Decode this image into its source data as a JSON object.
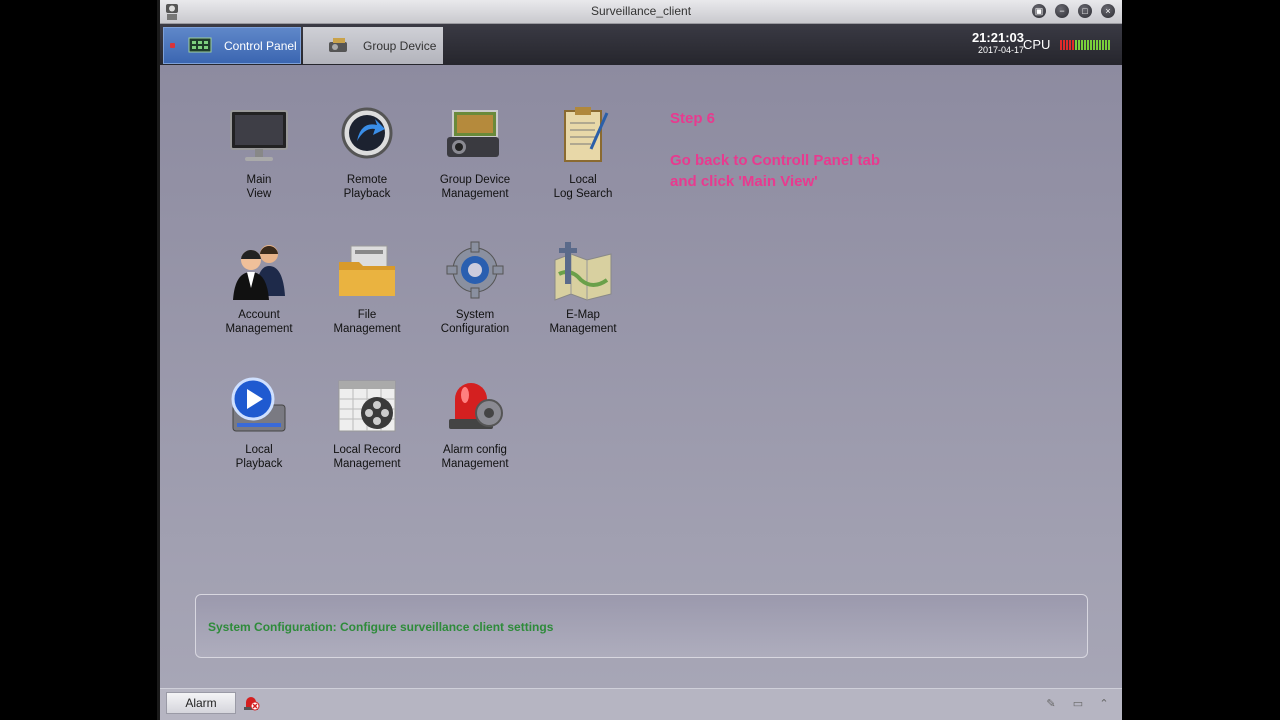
{
  "window": {
    "title": "Surveillance_client"
  },
  "tabs": [
    {
      "label": "Control Panel",
      "icon": "control-panel-icon"
    },
    {
      "label": "Group Device",
      "icon": "group-device-icon"
    }
  ],
  "clock": {
    "time": "21:21:03",
    "date": "2017-04-17"
  },
  "cpu": {
    "label": "CPU",
    "load_fraction": 0.3
  },
  "modules": [
    {
      "label": "Main\nView",
      "icon": "monitor-icon"
    },
    {
      "label": "Remote\nPlayback",
      "icon": "remote-playback-icon"
    },
    {
      "label": "Group Device\nManagement",
      "icon": "projector-icon"
    },
    {
      "label": "Local\nLog Search",
      "icon": "log-notepad-icon"
    },
    {
      "label": "Account\nManagement",
      "icon": "users-icon"
    },
    {
      "label": "File\nManagement",
      "icon": "folder-icon"
    },
    {
      "label": "System\nConfiguration",
      "icon": "gear-icon"
    },
    {
      "label": "E-Map\nManagement",
      "icon": "map-icon"
    },
    {
      "label": "Local\nPlayback",
      "icon": "play-icon"
    },
    {
      "label": "Local Record\nManagement",
      "icon": "film-calendar-icon"
    },
    {
      "label": "Alarm config\nManagement",
      "icon": "alarm-gear-icon"
    }
  ],
  "annotation": {
    "title": "Step 6",
    "body": "Go back to Controll Panel tab\nand click 'Main View'"
  },
  "info": {
    "text": "System Configuration: Configure surveillance client settings"
  },
  "statusbar": {
    "alarm_label": "Alarm"
  },
  "colors": {
    "accent": "#3b66b1",
    "annotation": "#e83a8f",
    "info_text": "#2e8b3a"
  }
}
